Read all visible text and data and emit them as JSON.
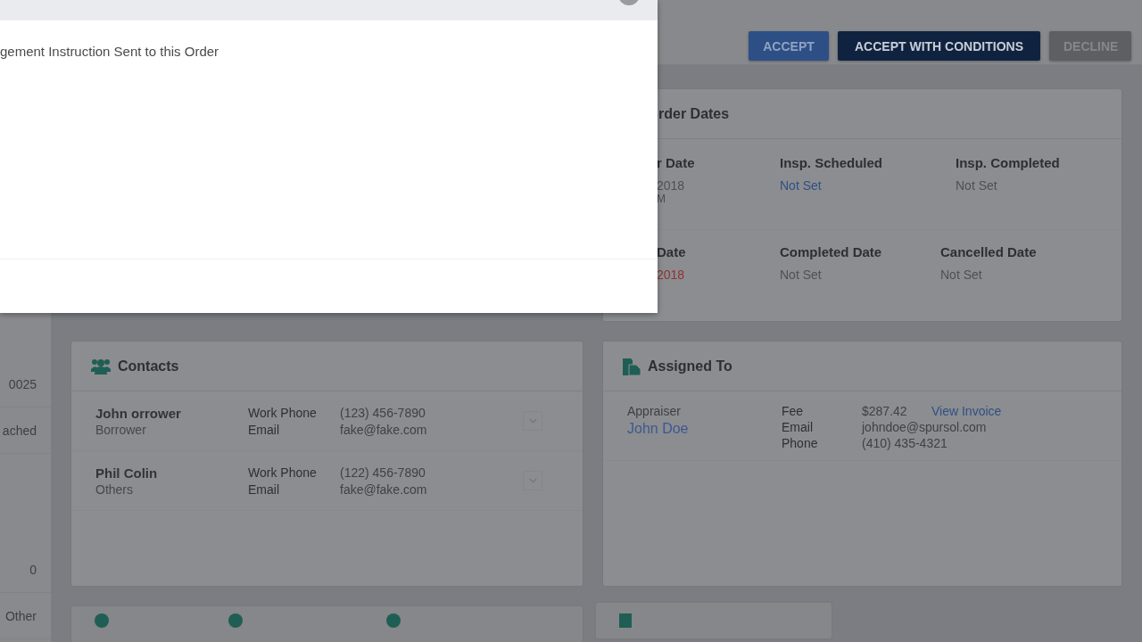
{
  "modal": {
    "message": "gement Instruction Sent to this Order"
  },
  "actions": [
    {
      "label": "ACCEPT",
      "kind": "primary"
    },
    {
      "label": "ACCEPT WITH CONDITIONS",
      "kind": "dark"
    },
    {
      "label": "DECLINE",
      "kind": "muted"
    }
  ],
  "sidebar": {
    "items": [
      "0025",
      "ached",
      "0",
      "Other"
    ]
  },
  "order_dates": {
    "title": "rder Dates",
    "rows": [
      [
        {
          "label": "r Date",
          "value": "2018",
          "note": "M",
          "linked": false,
          "overdue": false
        },
        {
          "label": "Insp. Scheduled",
          "value": "Not Set",
          "linked": true,
          "overdue": false
        },
        {
          "label": "Insp. Completed",
          "value": "Not Set",
          "linked": false,
          "overdue": false
        }
      ],
      [
        {
          "label": "Date",
          "value": "2018",
          "linked": false,
          "overdue": true
        },
        {
          "label": "Completed Date",
          "value": "Not Set",
          "linked": false,
          "overdue": false
        },
        {
          "label": "Cancelled Date",
          "value": "Not Set",
          "linked": false,
          "overdue": false
        }
      ]
    ]
  },
  "contacts": {
    "title": "Contacts",
    "items": [
      {
        "name": "John orrower",
        "role": "Borrower",
        "fields": [
          {
            "label": "Work Phone",
            "value": "(123) 456-7890"
          },
          {
            "label": "Email",
            "value": "fake@fake.com"
          }
        ]
      },
      {
        "name": "Phil Colin",
        "role": "Others",
        "fields": [
          {
            "label": "Work Phone",
            "value": "(122) 456-7890"
          },
          {
            "label": "Email",
            "value": "fake@fake.com"
          }
        ]
      }
    ]
  },
  "assigned": {
    "title": "Assigned To",
    "role": "Appraiser",
    "name": "John Doe",
    "fields": [
      {
        "label": "Fee",
        "value": "$287.42",
        "link": "View Invoice"
      },
      {
        "label": "Email",
        "value": "johndoe@spursol.com"
      },
      {
        "label": "Phone",
        "value": "(410) 435-4321"
      }
    ]
  }
}
